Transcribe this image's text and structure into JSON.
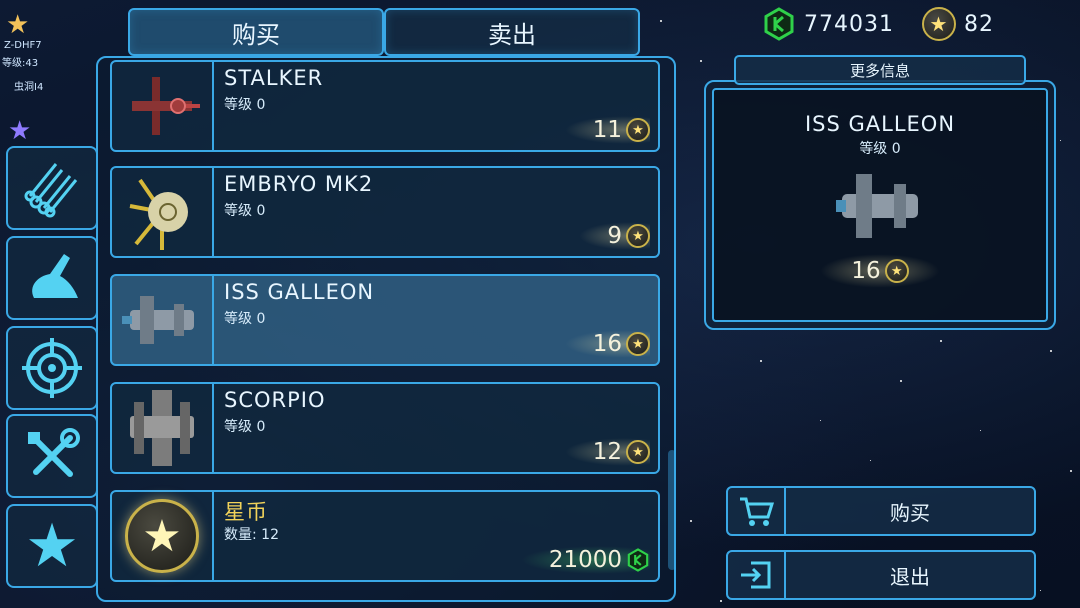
{
  "tabs": [
    {
      "label": "购买",
      "active": true
    },
    {
      "label": "卖出",
      "active": false
    }
  ],
  "currency": {
    "gems": "774031",
    "coins": "82"
  },
  "map_markers": [
    {
      "name": "Z-DHF7",
      "level": "等级:43"
    },
    {
      "name": "虫洞I4",
      "level": ""
    }
  ],
  "sidebar": {
    "items": [
      {
        "icon": "pipes-icon"
      },
      {
        "icon": "claw-icon"
      },
      {
        "icon": "target-icon"
      },
      {
        "icon": "tools-icon"
      },
      {
        "icon": "star-icon"
      }
    ]
  },
  "ships": [
    {
      "name": "STALKER",
      "level": "等级 0",
      "price": "11"
    },
    {
      "name": "EMBRYO MK2",
      "level": "等级 0",
      "price": "9"
    },
    {
      "name": "ISS GALLEON",
      "level": "等级 0",
      "price": "16",
      "selected": true
    },
    {
      "name": "SCORPIO",
      "level": "等级 0",
      "price": "12"
    }
  ],
  "coin_pack": {
    "name": "星币",
    "quantity": "数量: 12",
    "price": "21000"
  },
  "info": {
    "tab_label": "更多信息",
    "name": "ISS GALLEON",
    "level": "等级 0",
    "price": "16"
  },
  "actions": {
    "buy_label": "购买",
    "exit_label": "退出"
  },
  "colors": {
    "accent": "#3aa8e6",
    "gold": "#f2d35a",
    "gem_green": "#2fd14a"
  }
}
